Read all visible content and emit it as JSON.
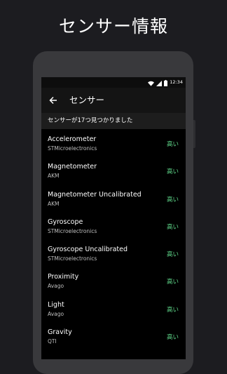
{
  "headline": "センサー情報",
  "status_bar": {
    "time": "12:34"
  },
  "toolbar": {
    "title": "センサー"
  },
  "summary": "センサーが17つ見つかりました",
  "colors": {
    "accent_green": "#5fd88a",
    "background": "#1c1c20"
  },
  "sensors": [
    {
      "name": "Accelerometer",
      "vendor": "STMicroelectronics",
      "power": "高い"
    },
    {
      "name": "Magnetometer",
      "vendor": "AKM",
      "power": "高い"
    },
    {
      "name": "Magnetometer Uncalibrated",
      "vendor": "AKM",
      "power": "高い"
    },
    {
      "name": "Gyroscope",
      "vendor": "STMicroelectronics",
      "power": "高い"
    },
    {
      "name": "Gyroscope Uncalibrated",
      "vendor": "STMicroelectronics",
      "power": "高い"
    },
    {
      "name": "Proximity",
      "vendor": "Avago",
      "power": "高い"
    },
    {
      "name": "Light",
      "vendor": "Avago",
      "power": "高い"
    },
    {
      "name": "Gravity",
      "vendor": "QTI",
      "power": "高い"
    }
  ]
}
